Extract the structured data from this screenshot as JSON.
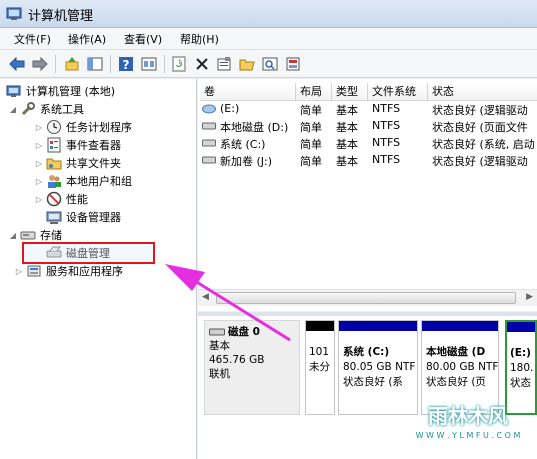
{
  "window": {
    "title": "计算机管理"
  },
  "menu": [
    "文件(F)",
    "操作(A)",
    "查看(V)",
    "帮助(H)"
  ],
  "toolbar": [
    "back-icon",
    "forward-icon",
    "up-icon",
    "show-hide-tree-icon",
    "help-icon",
    "console-view-icon",
    "refresh-icon",
    "delete-icon",
    "properties-icon",
    "open-folder-icon",
    "search-icon",
    "export-icon"
  ],
  "tree": {
    "root": "计算机管理 (本地)",
    "system_tools": "系统工具",
    "task_scheduler": "任务计划程序",
    "event_viewer": "事件查看器",
    "shared_folders": "共享文件夹",
    "local_users": "本地用户和组",
    "performance": "性能",
    "device_manager": "设备管理器",
    "storage": "存储",
    "disk_management": "磁盘管理",
    "services_apps": "服务和应用程序"
  },
  "list": {
    "columns": [
      "卷",
      "布局",
      "类型",
      "文件系统",
      "状态"
    ],
    "rows": [
      {
        "volume": "(E:)",
        "layout": "简单",
        "type": "基本",
        "fs": "NTFS",
        "status": "状态良好 (逻辑驱动"
      },
      {
        "volume": "本地磁盘 (D:)",
        "layout": "简单",
        "type": "基本",
        "fs": "NTFS",
        "status": "状态良好 (页面文件"
      },
      {
        "volume": "系统 (C:)",
        "layout": "简单",
        "type": "基本",
        "fs": "NTFS",
        "status": "状态良好 (系统, 启动"
      },
      {
        "volume": "新加卷 (J:)",
        "layout": "简单",
        "type": "基本",
        "fs": "NTFS",
        "status": "状态良好 (逻辑驱动"
      }
    ]
  },
  "disk": {
    "name": "磁盘 0",
    "kind": "基本",
    "size": "465.76 GB",
    "state": "联机",
    "partitions": [
      {
        "name": "",
        "size": "101",
        "status": "未分"
      },
      {
        "name": "系统 (C:)",
        "size": "80.05 GB NTF",
        "status": "状态良好 (系"
      },
      {
        "name": "本地磁盘 (D",
        "size": "80.00 GB NTF",
        "status": "状态良好 (页"
      },
      {
        "name": "(E:)",
        "size": "180.",
        "status": "状态"
      }
    ]
  },
  "watermark": {
    "title": "雨林木风",
    "url": "W W W . Y L M F U . C O M"
  },
  "colors": {
    "highlight_box": "#e0161a",
    "arrow": "#e52ee0",
    "primary_bar": "#0000aa",
    "unalloc_bar": "#000000"
  }
}
